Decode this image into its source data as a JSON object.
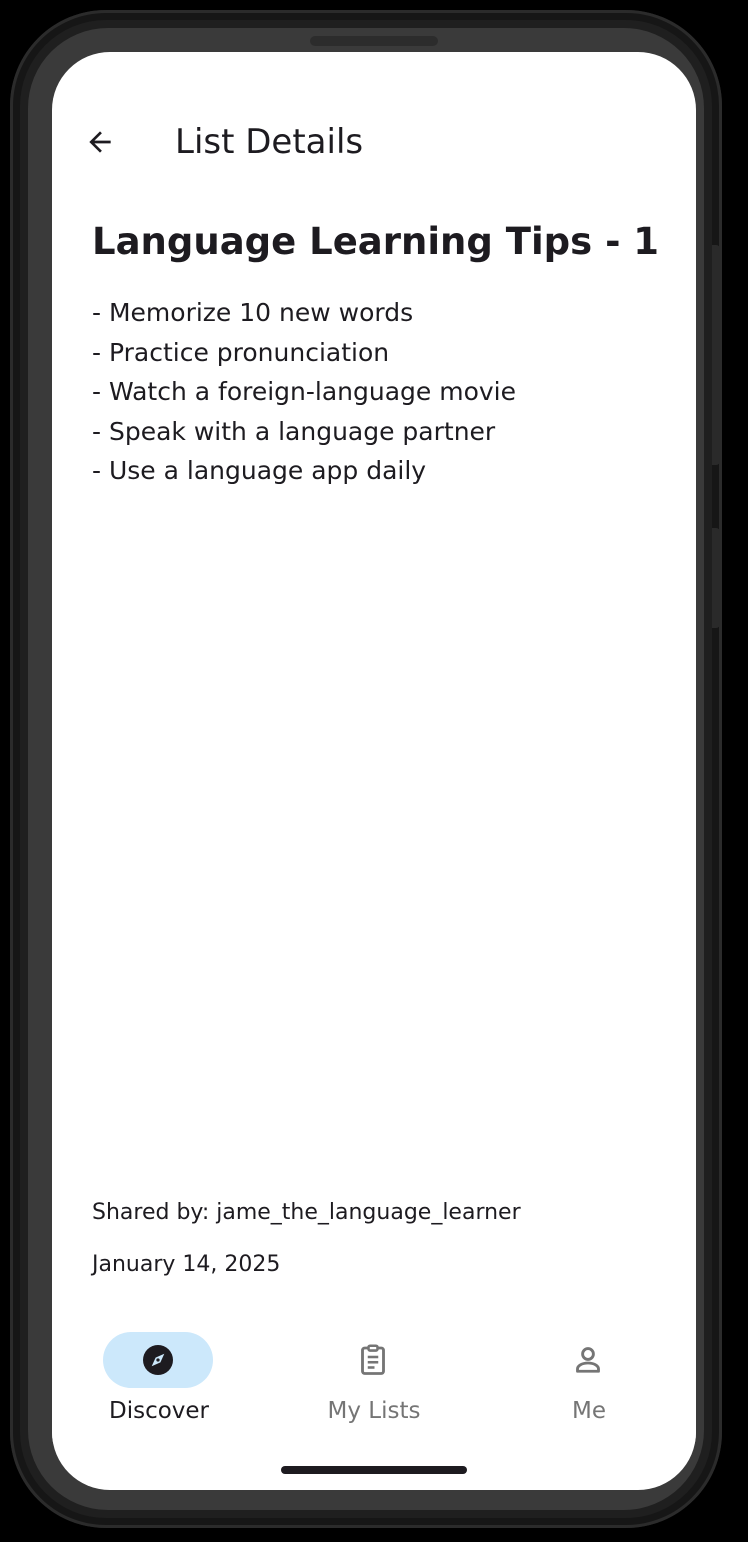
{
  "app_bar": {
    "back_icon": "arrow-back-icon",
    "title": "List Details"
  },
  "list": {
    "title": "Language Learning Tips - 1",
    "items": [
      "- Memorize 10 new words",
      "- Practice pronunciation",
      "- Watch a foreign-language movie",
      "- Speak with a language partner",
      "- Use a language app daily"
    ],
    "shared_by": "Shared by: jame_the_language_learner",
    "date": "January 14, 2025"
  },
  "nav": {
    "items": [
      {
        "label": "Discover",
        "icon": "compass-icon",
        "active": true
      },
      {
        "label": "My Lists",
        "icon": "clipboard-list-icon",
        "active": false
      },
      {
        "label": "Me",
        "icon": "person-icon",
        "active": false
      }
    ]
  },
  "colors": {
    "active_pill": "#cce8fb",
    "text_primary": "#1d1b20",
    "text_inactive": "#757575",
    "screen_background": "#ffffff"
  }
}
